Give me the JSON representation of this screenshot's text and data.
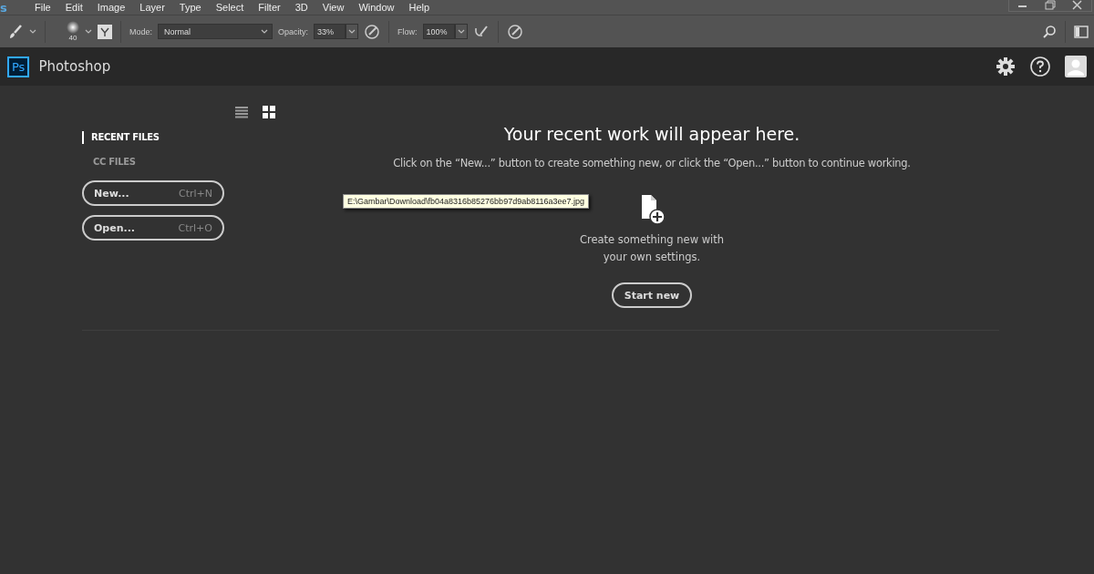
{
  "menu_bar": {
    "logo_text": "s",
    "items": [
      "File",
      "Edit",
      "Image",
      "Layer",
      "Type",
      "Select",
      "Filter",
      "3D",
      "View",
      "Window",
      "Help"
    ]
  },
  "options_bar": {
    "brush_size": "40",
    "mode_label": "Mode:",
    "mode_value": "Normal",
    "opacity_label": "Opacity:",
    "opacity_value": "33%",
    "flow_label": "Flow:",
    "flow_value": "100%"
  },
  "header": {
    "logo": "Ps",
    "title": "Photoshop"
  },
  "view_modes": [
    {
      "kind": "list",
      "selected": false
    },
    {
      "kind": "grid",
      "selected": true
    }
  ],
  "sidebar": {
    "tabs": [
      {
        "label": "RECENT FILES",
        "selected": true
      },
      {
        "label": "CC FILES",
        "selected": false
      }
    ],
    "buttons": [
      {
        "label": "New...",
        "shortcut": "Ctrl+N"
      },
      {
        "label": "Open...",
        "shortcut": "Ctrl+O"
      }
    ]
  },
  "main": {
    "heading": "Your recent work will appear here.",
    "subtext": "Click on the “New...” button to create something new, or click the “Open...” button to continue working.",
    "create_text": "Create something new with your own settings.",
    "start_button": "Start new"
  },
  "tooltip": "E:\\Gambar\\Download\\fb04a8316b85276bb97d9ab8116a3ee7.jpg"
}
